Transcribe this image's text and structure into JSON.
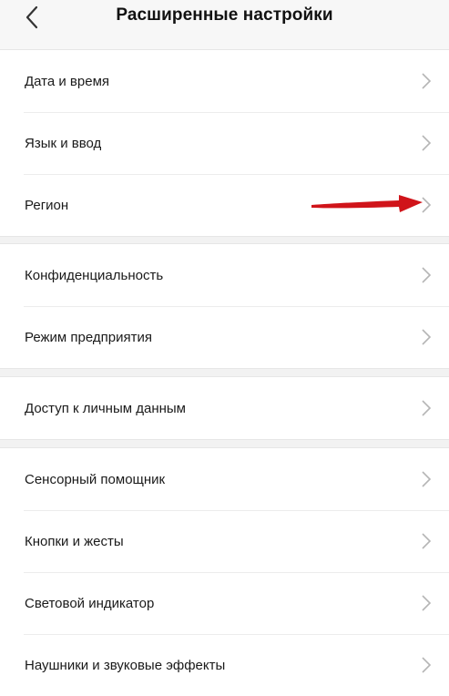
{
  "header": {
    "title": "Расширенные настройки",
    "back_icon": "chevron-left-icon"
  },
  "groups": [
    {
      "items": [
        {
          "label": "Дата и время"
        },
        {
          "label": "Язык и ввод"
        },
        {
          "label": "Регион"
        }
      ]
    },
    {
      "items": [
        {
          "label": "Конфиденциальность"
        },
        {
          "label": "Режим предприятия"
        }
      ]
    },
    {
      "items": [
        {
          "label": "Доступ к личным данным"
        }
      ]
    },
    {
      "items": [
        {
          "label": "Сенсорный помощник"
        },
        {
          "label": "Кнопки и жесты"
        },
        {
          "label": "Световой индикатор"
        },
        {
          "label": "Наушники и звуковые эффекты"
        }
      ]
    }
  ],
  "annotation": {
    "icon": "red-arrow-icon",
    "color": "#d0141a"
  },
  "colors": {
    "chevron": "#b5b5b5",
    "background": "#f2f2f2",
    "card": "#ffffff"
  }
}
